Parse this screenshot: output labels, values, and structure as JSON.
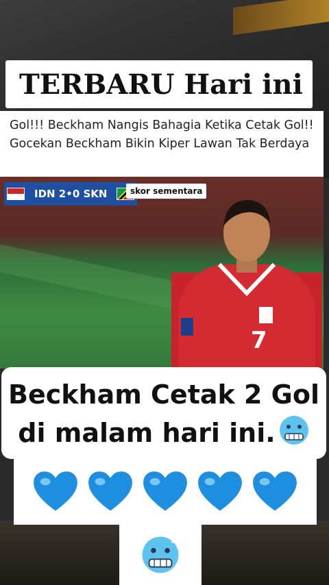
{
  "header": {
    "title": "TERBARU Hari ini"
  },
  "description": "Gol!!! Beckham Nangis Bahagia Ketika Cetak Gol!! Gocekan Beckham Bikin Kiper Lawan Tak Berdaya",
  "video": {
    "scorebug": {
      "score": "IDN 2•0 SKN",
      "status": "skor sementara"
    },
    "player_number": "7"
  },
  "caption": {
    "line1": "Beckham Cetak 2 Gol",
    "line2": "di malam hari ini.",
    "emoji": "cold-face-icon"
  },
  "hearts": {
    "count": 5,
    "icon": "blue-heart-icon",
    "color": "#1e8fe0"
  },
  "footer_emoji": "cold-face-icon"
}
